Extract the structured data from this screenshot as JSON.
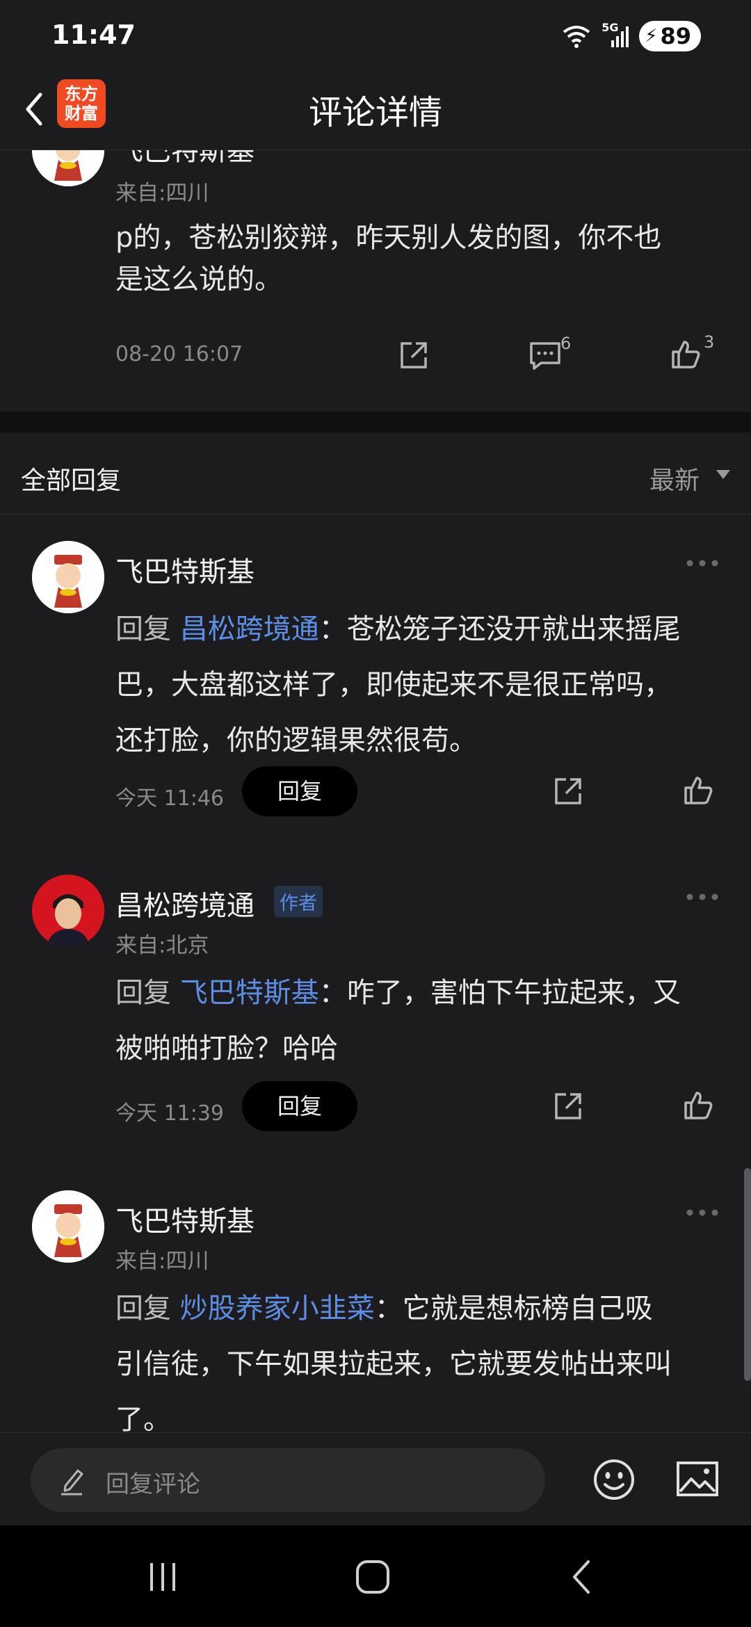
{
  "status_bar": {
    "time": "11:47",
    "network": "5G",
    "battery": "89"
  },
  "header": {
    "title": "评论详情",
    "logo_line1": "东方",
    "logo_line2": "财富"
  },
  "main_comment": {
    "author": "飞巴特斯基",
    "location": "来自:四川",
    "text_line1": "p的，苍松别狡辩，昨天别人发的图，你不也",
    "text_line2": "是这么说的。",
    "timestamp": "08-20 16:07",
    "comment_count": "6",
    "like_count": "3"
  },
  "replies_header": {
    "title": "全部回复",
    "sort": "最新"
  },
  "replies": [
    {
      "author": "飞巴特斯基",
      "prefix": "回复",
      "mention": "昌松跨境通",
      "line1": "：苍松笼子还没开就出来摇尾",
      "line2": "巴，大盘都这样了，即使起来不是很正常吗，",
      "line3": "还打脸，你的逻辑果然很苟。",
      "timestamp": "今天 11:46",
      "reply_label": "回复"
    },
    {
      "author": "昌松跨境通",
      "badge": "作者",
      "location": "来自:北京",
      "prefix": "回复",
      "mention": "飞巴特斯基",
      "line1": "：咋了，害怕下午拉起来，又",
      "line2": "被啪啪打脸？哈哈",
      "timestamp": "今天 11:39",
      "reply_label": "回复"
    },
    {
      "author": "飞巴特斯基",
      "location": "来自:四川",
      "prefix": "回复",
      "mention": "炒股养家小韭菜",
      "line1": "：它就是想标榜自己吸",
      "line2": "引信徒，下午如果拉起来，它就要发帖出来叫",
      "line3": "了。"
    }
  ],
  "bottom_bar": {
    "placeholder": "回复评论"
  },
  "colors": {
    "background": "#1c1c1e",
    "mention": "#5d8ee6",
    "logo": "#f04a22"
  }
}
